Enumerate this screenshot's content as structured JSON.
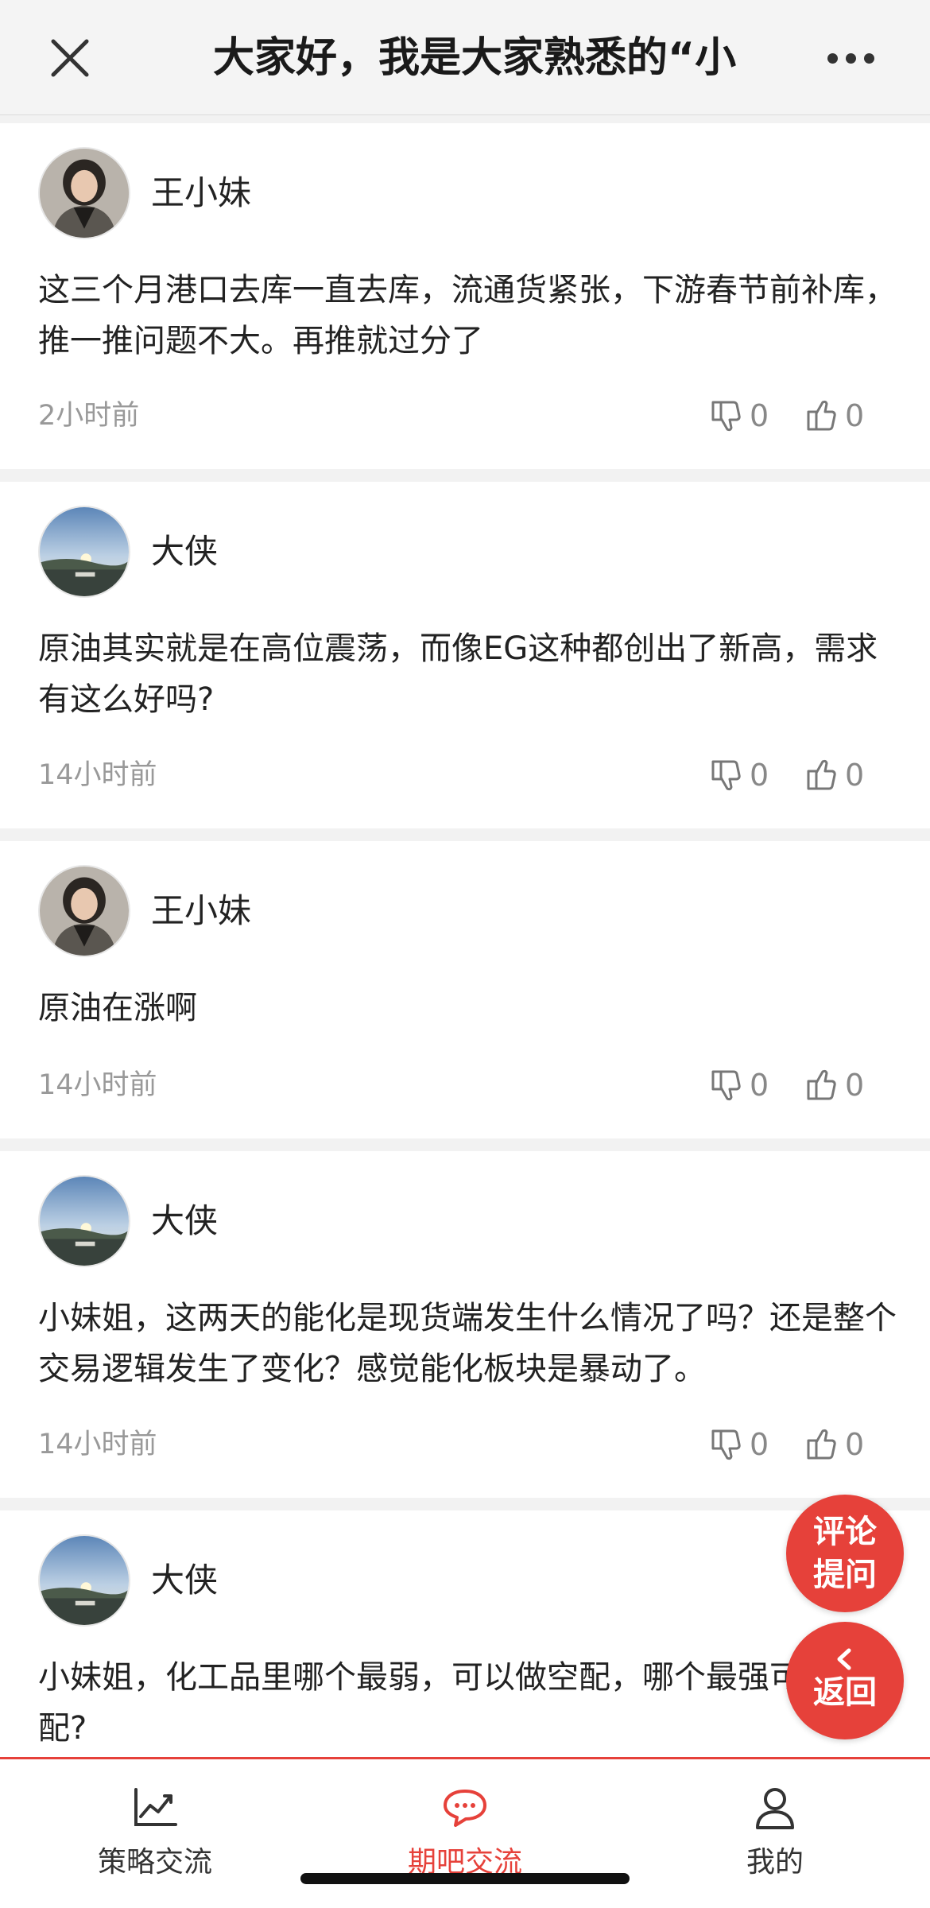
{
  "header": {
    "title": "大家好，我是大家熟悉的“小",
    "close_icon": "close-icon",
    "more_icon": "more-icon"
  },
  "comments": [
    {
      "username": "王小妹",
      "avatar": "avatar-woman",
      "content": "这三个月港口去库一直去库，流通货紧张，下游春节前补库，推一推问题不大。再推就过分了",
      "time": "2小时前",
      "dislikes": "0",
      "likes": "0"
    },
    {
      "username": "大侠",
      "avatar": "avatar-landscape",
      "content": "原油其实就是在高位震荡，而像EG这种都创出了新高，需求有这么好吗?",
      "time": "14小时前",
      "dislikes": "0",
      "likes": "0"
    },
    {
      "username": "王小妹",
      "avatar": "avatar-woman",
      "content": "原油在涨啊",
      "time": "14小时前",
      "dislikes": "0",
      "likes": "0"
    },
    {
      "username": "大侠",
      "avatar": "avatar-landscape",
      "content": "小妹姐，这两天的能化是现货端发生什么情况了吗？还是整个交易逻辑发生了变化？感觉能化板块是暴动了。",
      "time": "14小时前",
      "dislikes": "0",
      "likes": "0"
    },
    {
      "username": "大侠",
      "avatar": "avatar-landscape",
      "content": "小妹姐，化工品里哪个最弱，可以做空配，哪个最强可以做多配?",
      "time": "",
      "dislikes": "",
      "likes": ""
    }
  ],
  "fab": {
    "comment_line1": "评论",
    "comment_line2": "提问",
    "back_label": "返回"
  },
  "tabbar": {
    "tabs": [
      {
        "label": "策略交流",
        "icon": "trend-chart-icon",
        "active": false
      },
      {
        "label": "期吧交流",
        "icon": "chat-bubble-icon",
        "active": true
      },
      {
        "label": "我的",
        "icon": "user-icon",
        "active": false
      }
    ]
  },
  "colors": {
    "accent": "#e6413a",
    "text": "#222222",
    "muted": "#999999"
  }
}
